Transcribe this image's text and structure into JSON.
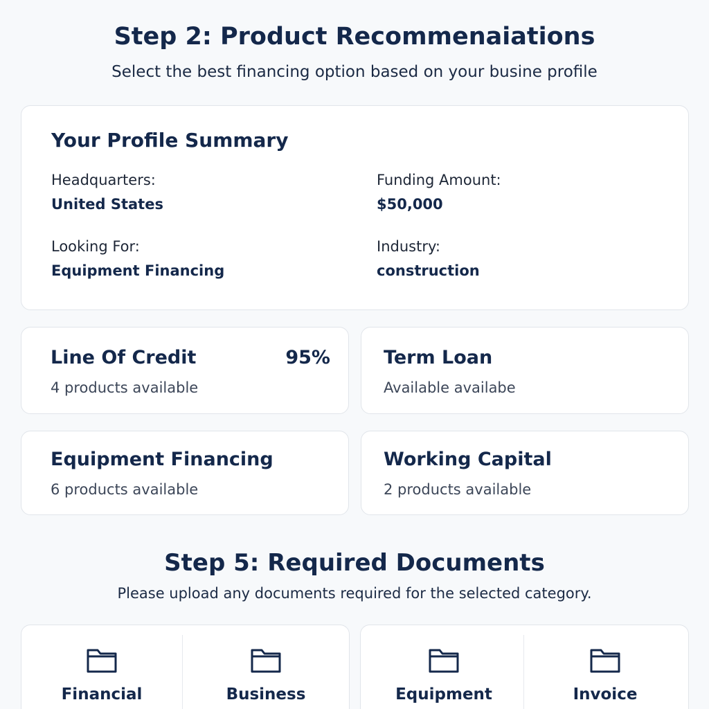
{
  "step2": {
    "title": "Step 2: Product Recommenaiations",
    "subtitle": "Select the best financing option based on your busine profile"
  },
  "profile": {
    "heading": "Your Profile Summary",
    "headquarters_label": "Headquarters:",
    "headquarters_value": "United States",
    "funding_label": "Funding Amount:",
    "funding_value": "$50,000",
    "looking_label": "Looking For:",
    "looking_value": "Equipment Financing",
    "industry_label": "Industry:",
    "industry_value": "construction"
  },
  "categories": [
    {
      "name": "Line Of Credit",
      "count": "4 products available",
      "match": "95%"
    },
    {
      "name": "Term Loan",
      "count": "Available availabe"
    },
    {
      "name": "Equipment Financing",
      "count": "6 products available"
    },
    {
      "name": "Working Capital",
      "count": "2 products available"
    }
  ],
  "step5": {
    "title": "Step 5: Required Documents",
    "subtitle": "Please upload any documents required for the selected category."
  },
  "documents": [
    {
      "label": "Financial",
      "icon": "folder-icon"
    },
    {
      "label": "Business",
      "icon": "folder-icon"
    },
    {
      "label": "Equipment",
      "icon": "folder-icon"
    },
    {
      "label": "Invoice",
      "icon": "folder-icon"
    }
  ],
  "colors": {
    "background": "#f7f9fb",
    "card": "#ffffff",
    "border": "#e1e5ea",
    "heading": "#14284b"
  }
}
